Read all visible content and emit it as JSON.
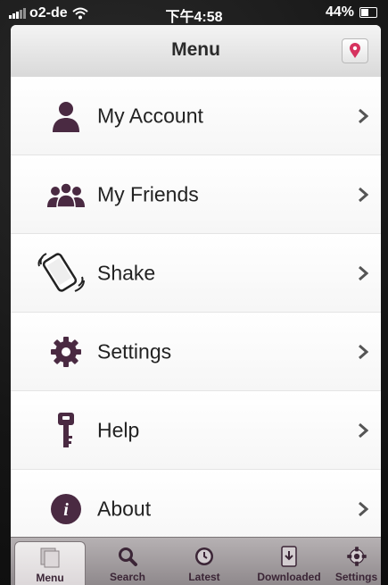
{
  "status_bar": {
    "carrier": "o2-de",
    "time": "下午4:58",
    "battery": "44%"
  },
  "navbar": {
    "title": "Menu",
    "pin_icon": "map-pin-icon"
  },
  "menu_items": [
    {
      "label": "My Account",
      "icon": "person-icon"
    },
    {
      "label": "My Friends",
      "icon": "group-icon"
    },
    {
      "label": "Shake",
      "icon": "phone-shake-icon"
    },
    {
      "label": "Settings",
      "icon": "gear-icon"
    },
    {
      "label": "Help",
      "icon": "key-icon"
    },
    {
      "label": "About",
      "icon": "info-icon"
    }
  ],
  "tabs": [
    {
      "label": "Menu",
      "icon": "pages-icon",
      "active": true
    },
    {
      "label": "Search",
      "icon": "search-icon"
    },
    {
      "label": "Latest",
      "icon": "clock-icon"
    },
    {
      "label": "Downloaded",
      "icon": "download-icon"
    },
    {
      "label": "Settings",
      "icon": "gear-icon"
    }
  ],
  "colors": {
    "accent": "#4a2a42",
    "pin": "#d6335f"
  }
}
